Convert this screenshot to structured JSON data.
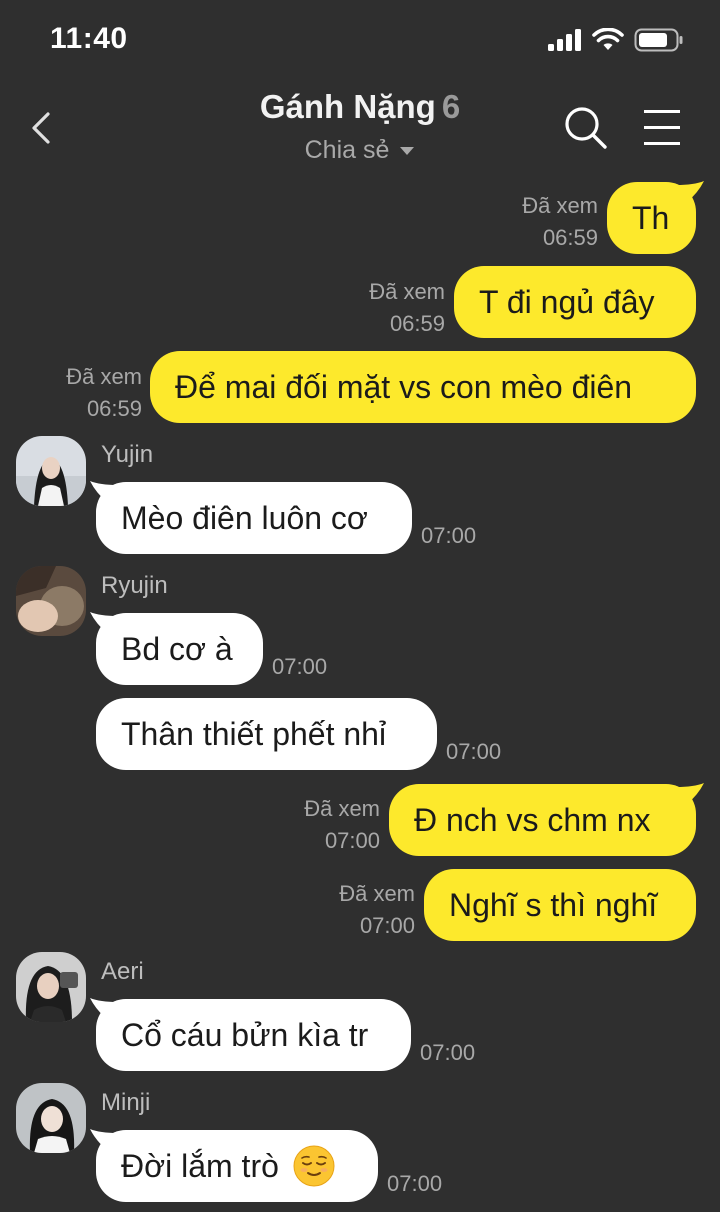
{
  "status_bar": {
    "time": "11:40"
  },
  "header": {
    "title": "Gánh Nặng",
    "member_count": "6",
    "subtitle": "Chia sẻ"
  },
  "colors": {
    "background": "#2f2f2f",
    "outgoing_bubble": "#fde92c",
    "incoming_bubble": "#ffffff",
    "meta_text": "#a8a8a8"
  },
  "messages": [
    {
      "direction": "outgoing",
      "text": "Th",
      "read_label": "Đã xem",
      "time": "06:59"
    },
    {
      "direction": "outgoing",
      "text": "T đi ngủ đây",
      "read_label": "Đã xem",
      "time": "06:59"
    },
    {
      "direction": "outgoing",
      "text": "Để mai đối mặt vs con mèo điên",
      "read_label": "Đã xem",
      "time": "06:59"
    },
    {
      "direction": "incoming",
      "sender": "Yujin",
      "text": "Mèo điên luôn cơ",
      "time": "07:00"
    },
    {
      "direction": "incoming",
      "sender": "Ryujin",
      "text": "Bd cơ à",
      "time": "07:00"
    },
    {
      "direction": "incoming",
      "sender": "Ryujin",
      "text": "Thân thiết phết nhỉ",
      "time": "07:00"
    },
    {
      "direction": "outgoing",
      "text": "Đ nch vs chm nx",
      "read_label": "Đã xem",
      "time": "07:00"
    },
    {
      "direction": "outgoing",
      "text": "Nghĩ s thì nghĩ",
      "read_label": "Đã xem",
      "time": "07:00"
    },
    {
      "direction": "incoming",
      "sender": "Aeri",
      "text": "Cổ cáu bửn kìa tr",
      "time": "07:00"
    },
    {
      "direction": "incoming",
      "sender": "Minji",
      "text": "Đời lắm trò",
      "emoji": "relieved-face",
      "time": "07:00"
    }
  ]
}
